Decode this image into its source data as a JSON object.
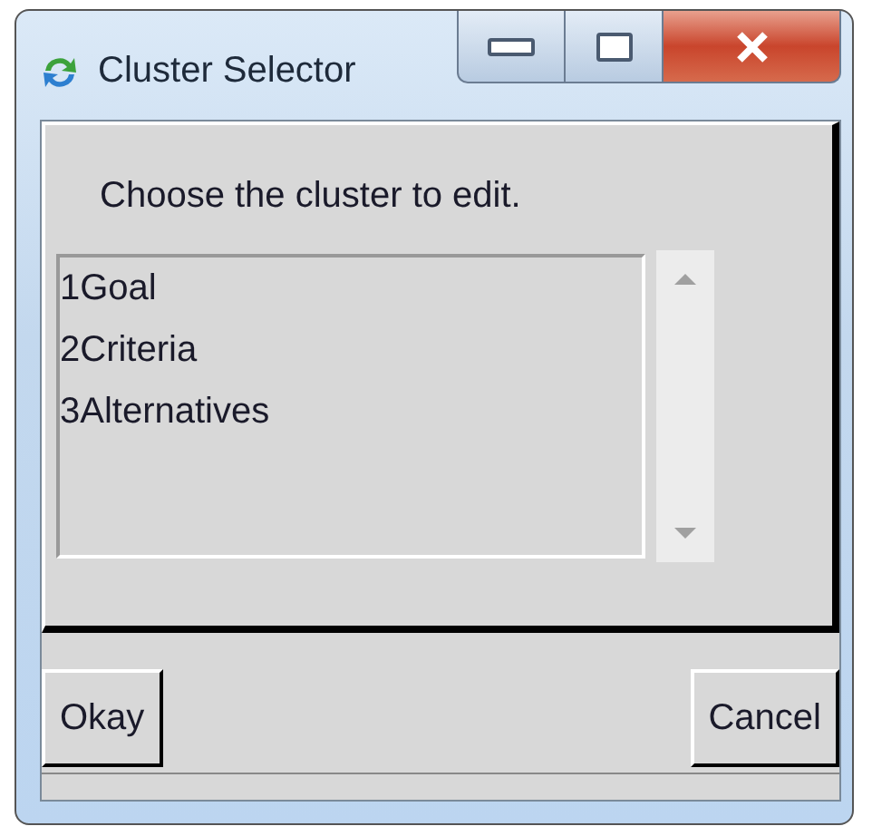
{
  "window": {
    "title": "Cluster Selector"
  },
  "prompt": "Choose the cluster to edit.",
  "clusters": [
    {
      "label": "1Goal",
      "selected": false
    },
    {
      "label": "2Criteria",
      "selected": false
    },
    {
      "label": "3Alternatives",
      "selected": false
    }
  ],
  "buttons": [
    {
      "label": "Okay"
    },
    {
      "label": "Cancel"
    }
  ]
}
